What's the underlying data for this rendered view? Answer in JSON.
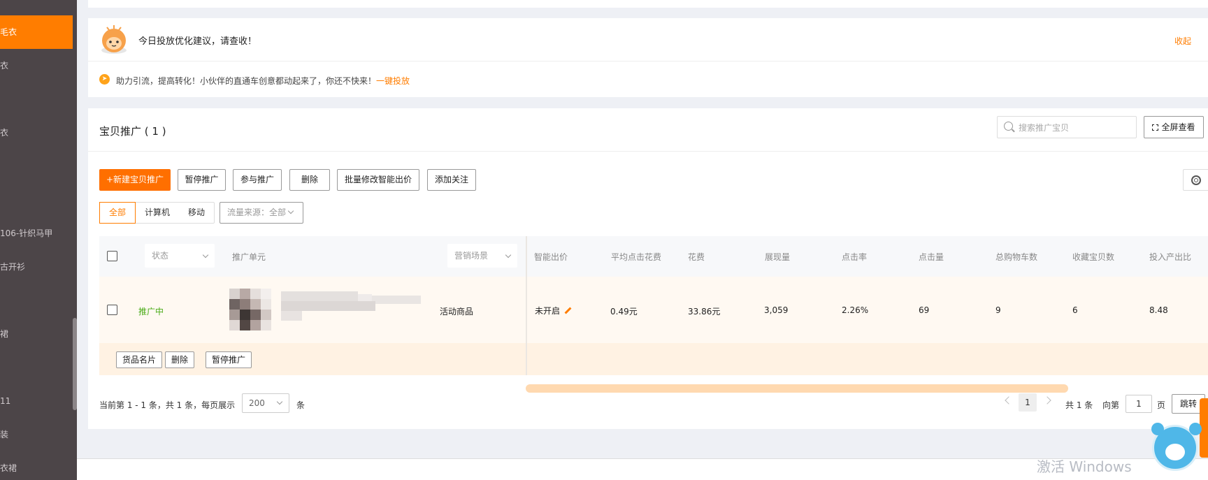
{
  "sidebar": {
    "items": [
      {
        "label": "毛衣",
        "active": true
      },
      {
        "label": "衣",
        "active": false
      },
      {
        "label": "衣",
        "active": false
      },
      {
        "label": "",
        "active": false
      },
      {
        "label": "106-针织马甲",
        "active": false
      },
      {
        "label": "古开衫",
        "active": false
      },
      {
        "label": "裙",
        "active": false
      },
      {
        "label": "11",
        "active": false
      },
      {
        "label": "装",
        "active": false
      },
      {
        "label": "衣裙",
        "active": false
      }
    ]
  },
  "suggestion": {
    "title": "今日投放优化建议，请查收！",
    "collapse_label": "收起",
    "tip_text": "助力引流，提高转化！小伙伴的直通车创意都动起来了，你还不快来！",
    "tip_link": "一键投放"
  },
  "main": {
    "title": "宝贝推广 ( 1 )",
    "search_placeholder": "搜索推广宝贝",
    "fullscreen_label": "全屏查看",
    "toolbar": {
      "new_label": "+新建宝贝推广",
      "pause_label": "暂停推广",
      "join_label": "参与推广",
      "delete_label": "删除",
      "batch_bid_label": "批量修改智能出价",
      "follow_label": "添加关注"
    },
    "device_tabs": [
      {
        "label": "全部",
        "active": true
      },
      {
        "label": "计算机",
        "active": false
      },
      {
        "label": "移动",
        "active": false
      }
    ],
    "traffic_source": "流量来源：全部"
  },
  "table": {
    "headers": {
      "status": "状态",
      "unit": "推广单元",
      "scene": "营销场景",
      "smart_bid": "智能出价",
      "avg_cpc": "平均点击花费",
      "cost": "花费",
      "impressions": "展现量",
      "ctr": "点击率",
      "clicks": "点击量",
      "cart": "总购物车数",
      "favorites": "收藏宝贝数",
      "roi": "投入产出比"
    },
    "row": {
      "status": "推广中",
      "scene": "活动商品",
      "smart_bid": "未开启",
      "avg_cpc": "0.49元",
      "cost": "33.86元",
      "impressions": "3,059",
      "ctr": "2.26%",
      "clicks": "69",
      "cart": "9",
      "favorites": "6",
      "roi": "8.48"
    },
    "row_actions": {
      "card_label": "货品名片",
      "delete_label": "删除",
      "pause_label": "暂停推广"
    }
  },
  "pagination": {
    "summary": "当前第 1 - 1 条，共 1 条，每页展示",
    "page_size": "200",
    "unit": "条",
    "current_page": "1",
    "total_text": "共 1 条",
    "goto_label": "向第",
    "goto_value": "1",
    "page_unit": "页",
    "jump_label": "跳转"
  },
  "watermark": "激活 Windows",
  "colors": {
    "accent": "#ff7d00",
    "status_active": "#4aab17",
    "sidebar_bg": "#4c4548"
  }
}
